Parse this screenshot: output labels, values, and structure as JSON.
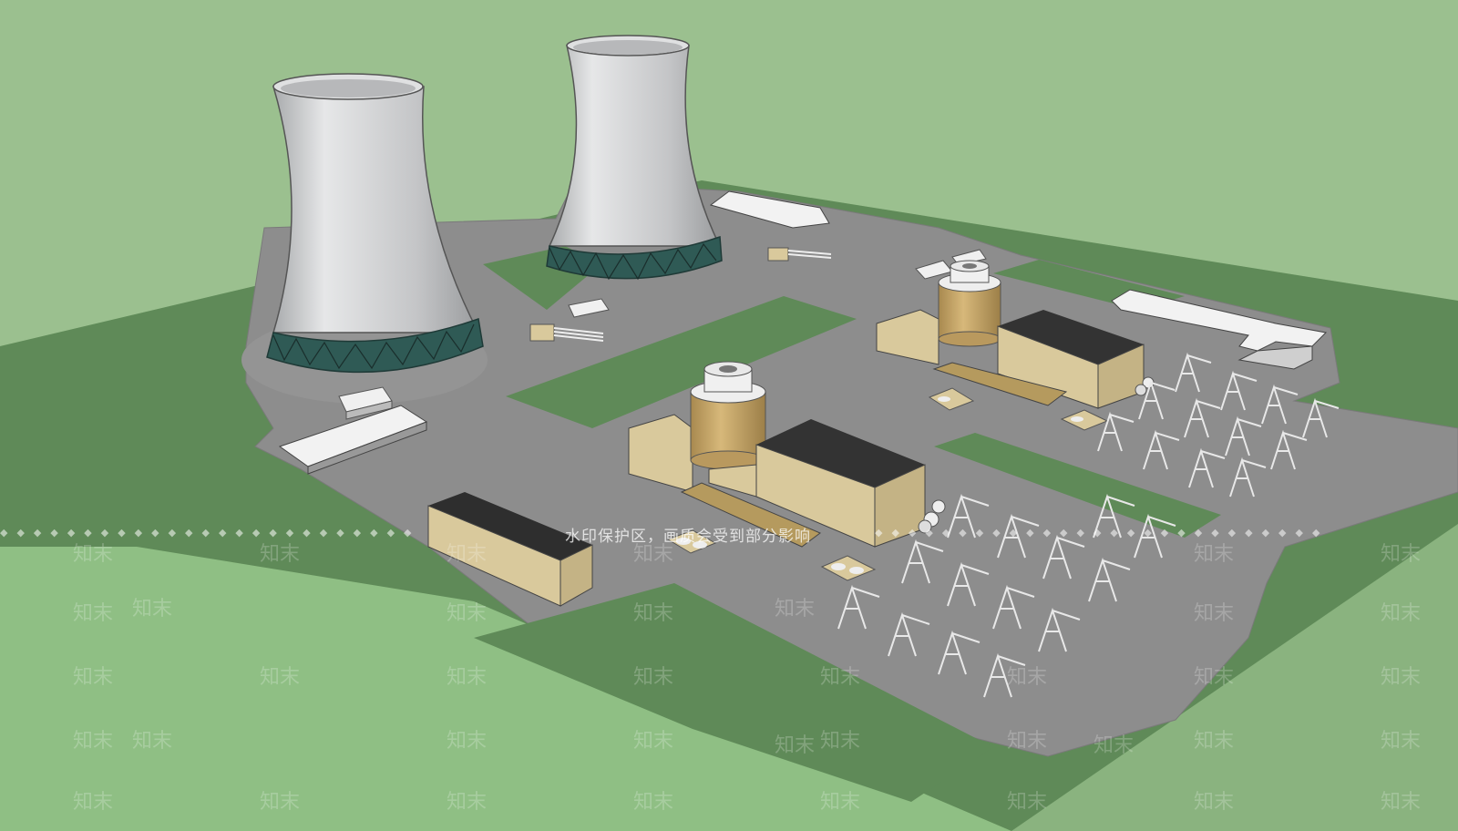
{
  "watermark": {
    "notice": "水印保护区，画质会受到部分影响",
    "brand": "知末"
  },
  "colors": {
    "sky": "#9bc08f",
    "field": "#6a9162",
    "ground_light": "#8fb886",
    "pavement": "#8f8f8f",
    "tower_body": "#c9cacb",
    "tower_base": "#2f5a55",
    "containment": "#c9a86a",
    "building": "#d9c99c",
    "roof": "#333333"
  },
  "scene": {
    "cooling_towers": 2,
    "reactor_units": 2
  }
}
